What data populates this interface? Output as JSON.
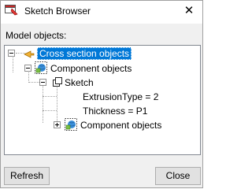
{
  "window": {
    "title": "Sketch Browser",
    "close_glyph": "✕"
  },
  "section_label": "Model objects:",
  "tree": {
    "root": {
      "label": "Cross section objects",
      "icon": "cross-section-icon",
      "selected": true,
      "expanded": true
    },
    "component_objects": {
      "label": "Component objects",
      "icon": "component-objects-icon",
      "expanded": true
    },
    "sketch": {
      "label": "Sketch",
      "icon": "sketch-icon",
      "expanded": true
    },
    "extrusion_type": {
      "label": "ExtrusionType = 2"
    },
    "thickness": {
      "label": "Thickness = P1"
    },
    "nested_component_objects": {
      "label": "Component objects",
      "icon": "component-objects-icon",
      "expanded": false
    }
  },
  "buttons": {
    "refresh": "Refresh",
    "close": "Close"
  },
  "colors": {
    "selection": "#0078d7",
    "window_bg": "#f0f0f0"
  }
}
